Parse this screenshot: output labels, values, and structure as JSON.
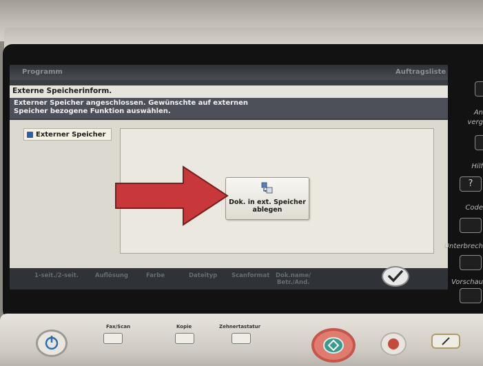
{
  "screen": {
    "left_tab": "Programm",
    "right_tab": "Auftragsliste",
    "dialog_title": "Externe Speicherinform.",
    "message_line1": "Externer Speicher angeschlossen. Gewünschte auf externen",
    "message_line2": "Speicher bezogene Funktion auswählen.",
    "side_tab_label": "Externer Speicher",
    "main_button_line1": "Dok. in ext. Speicher",
    "main_button_line2": "ablegen",
    "function_tabs": [
      "1-seit./2-seit.",
      "Auflösung",
      "Farbe",
      "Dateityp",
      "Scanformat",
      "Dok.name/",
      "Betr./And."
    ]
  },
  "right_keys": {
    "key1": "An",
    "key1b": "verg",
    "help": "Hilf",
    "help_glyph": "?",
    "code": "Code",
    "interrupt": "Unterbrech",
    "preview": "Vorschau"
  },
  "bottom_keys": {
    "fax_scan": "Fax/Scan",
    "copy": "Kopie",
    "keypad": "Zehnertastatur"
  },
  "colors": {
    "arrow_red": "#c8383a",
    "start_button": "#3a9a8c",
    "stop_button": "#c54a3e"
  }
}
